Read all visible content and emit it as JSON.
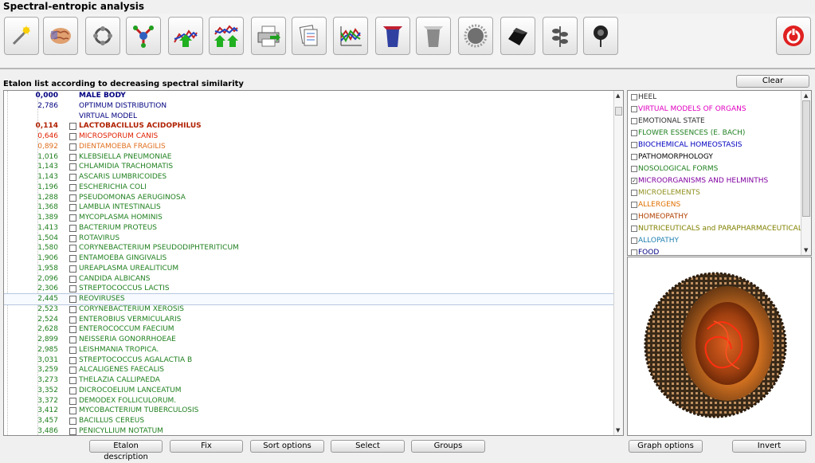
{
  "window": {
    "title": "Spectral-entropic analysis"
  },
  "toolbar": {
    "buttons": [
      {
        "name": "wand-button",
        "icon": "magic-wand-icon"
      },
      {
        "name": "brain-button",
        "icon": "brain-icon"
      },
      {
        "name": "molecule-button",
        "icon": "molecule-icon"
      },
      {
        "name": "network-button",
        "icon": "network-icon"
      },
      {
        "name": "graph-up-button",
        "icon": "graph-up-icon"
      },
      {
        "name": "graph-compare-button",
        "icon": "graph-compare-icon"
      },
      {
        "name": "print-button",
        "icon": "printer-icon"
      },
      {
        "name": "documents-button",
        "icon": "documents-icon"
      },
      {
        "name": "spectrum-button",
        "icon": "spectrum-icon"
      },
      {
        "name": "blue-cup-button",
        "icon": "blue-cup-icon"
      },
      {
        "name": "grey-cup-button",
        "icon": "grey-cup-icon"
      },
      {
        "name": "virus-button",
        "icon": "virus-icon"
      },
      {
        "name": "microscope-button",
        "icon": "microscope-icon"
      },
      {
        "name": "black-stone-button",
        "icon": "black-stone-icon"
      },
      {
        "name": "plant-button",
        "icon": "plant-icon"
      },
      {
        "name": "flower-button",
        "icon": "flower-icon"
      }
    ],
    "power_icon": "power-icon"
  },
  "etalon": {
    "title": "Etalon list according to decreasing spectral similarity",
    "clear_label": "Clear",
    "rows": [
      {
        "value": "0,000",
        "name": "MALE BODY",
        "checkbox": false,
        "bold": true,
        "color": "#000080"
      },
      {
        "value": "2,786",
        "name": "OPTIMUM DISTRIBUTION",
        "checkbox": false,
        "color": "#000080"
      },
      {
        "value": "",
        "name": "VIRTUAL MODEL",
        "checkbox": false,
        "color": "#000080"
      },
      {
        "value": "0,114",
        "name": "LACTOBACILLUS ACIDOPHILUS",
        "checkbox": true,
        "bold": true,
        "color": "#b02000"
      },
      {
        "value": "0,646",
        "name": "MICROSPORUM  CANIS",
        "checkbox": true,
        "color": "#e02000"
      },
      {
        "value": "0,892",
        "name": "DIENTAMOEBA FRAGILIS",
        "checkbox": true,
        "color": "#e07020"
      },
      {
        "value": "1,016",
        "name": "KLEBSIELLA PNEUMONIAE",
        "checkbox": true,
        "color": "#208020"
      },
      {
        "value": "1,143",
        "name": "CHLAMIDIA  TRACHOMATIS",
        "checkbox": true,
        "color": "#208020"
      },
      {
        "value": "1,143",
        "name": "ASCARIS  LUMBRICOIDES",
        "checkbox": true,
        "color": "#208020"
      },
      {
        "value": "1,196",
        "name": "ESCHERICHIA  COLI",
        "checkbox": true,
        "color": "#208020"
      },
      {
        "value": "1,288",
        "name": "PSEUDOMONAS  AERUGINOSA",
        "checkbox": true,
        "color": "#208020"
      },
      {
        "value": "1,368",
        "name": "LAMBLIA  INTESTINALIS",
        "checkbox": true,
        "color": "#208020"
      },
      {
        "value": "1,389",
        "name": "MYCOPLASMA  HOMINIS",
        "checkbox": true,
        "color": "#208020"
      },
      {
        "value": "1,413",
        "name": "BACTERIUM  PROTEUS",
        "checkbox": true,
        "color": "#208020"
      },
      {
        "value": "1,504",
        "name": "ROTAVIRUS",
        "checkbox": true,
        "color": "#208020"
      },
      {
        "value": "1,580",
        "name": "CORYNEBACTERIUM PSEUDODIPHTERITICUM",
        "checkbox": true,
        "color": "#208020"
      },
      {
        "value": "1,906",
        "name": "ENTAMOEBA GINGIVALIS",
        "checkbox": true,
        "color": "#208020"
      },
      {
        "value": "1,958",
        "name": "UREAPLASMA  UREALITICUM",
        "checkbox": true,
        "color": "#208020"
      },
      {
        "value": "2,096",
        "name": "CANDIDA  ALBICANS",
        "checkbox": true,
        "color": "#208020"
      },
      {
        "value": "2,306",
        "name": "STREPTOCOCCUS LACTIS",
        "checkbox": true,
        "color": "#208020"
      },
      {
        "value": "2,445",
        "name": "REOVIRUSES",
        "checkbox": true,
        "color": "#208020",
        "highlight": true
      },
      {
        "value": "2,523",
        "name": "CORYNEBACTERIUM XEROSIS",
        "checkbox": true,
        "color": "#208020"
      },
      {
        "value": "2,524",
        "name": "ENTEROBIUS  VERMICULARIS",
        "checkbox": true,
        "color": "#208020"
      },
      {
        "value": "2,628",
        "name": "ENTEROCOCCUM  FAECIUM",
        "checkbox": true,
        "color": "#208020"
      },
      {
        "value": "2,899",
        "name": "NEISSERIA  GONORRHOEAE",
        "checkbox": true,
        "color": "#208020"
      },
      {
        "value": "2,985",
        "name": "LEISHMANIA TROPICA.",
        "checkbox": true,
        "color": "#208020"
      },
      {
        "value": "3,031",
        "name": "STREPTOCOCCUS AGALACTIA  B",
        "checkbox": true,
        "color": "#208020"
      },
      {
        "value": "3,259",
        "name": "ALCALIGENES FAECALIS",
        "checkbox": true,
        "color": "#208020"
      },
      {
        "value": "3,273",
        "name": "THELAZIA CALLIPAEDA",
        "checkbox": true,
        "color": "#208020"
      },
      {
        "value": "3,352",
        "name": "DICROCOELIUM LANCEATUM",
        "checkbox": true,
        "color": "#208020"
      },
      {
        "value": "3,372",
        "name": "DEMODEX FOLLICULORUM.",
        "checkbox": true,
        "color": "#208020"
      },
      {
        "value": "3,412",
        "name": "MYCOBACTERIUM  TUBERCULOSIS",
        "checkbox": true,
        "color": "#208020"
      },
      {
        "value": "3,457",
        "name": "BACILLUS CEREUS",
        "checkbox": true,
        "color": "#208020"
      },
      {
        "value": "3,486",
        "name": "PENICYLLIUM  NOTATUM",
        "checkbox": true,
        "color": "#208020"
      }
    ]
  },
  "categories": [
    {
      "name": "HEEL",
      "color": "#303030",
      "checked": false
    },
    {
      "name": "VIRTUAL MODELS OF ORGANS",
      "color": "#e000c0",
      "checked": false
    },
    {
      "name": "EMOTIONAL STATE",
      "color": "#303030",
      "checked": false
    },
    {
      "name": "FLOWER ESSENCES (E. BACH)",
      "color": "#208020",
      "checked": false
    },
    {
      "name": "BIOCHEMICAL HOMEOSTASIS",
      "color": "#0000c0",
      "checked": false
    },
    {
      "name": "PATHOMORPHOLOGY",
      "color": "#000000",
      "checked": false
    },
    {
      "name": "NOSOLOGICAL FORMS",
      "color": "#208020",
      "checked": false
    },
    {
      "name": "MICROORGANISMS AND HELMINTHS",
      "color": "#8000a0",
      "checked": true
    },
    {
      "name": "MICROELEMENTS",
      "color": "#909020",
      "checked": false
    },
    {
      "name": "ALLERGENS",
      "color": "#e07000",
      "checked": false
    },
    {
      "name": "HOMEOPATHY",
      "color": "#b04000",
      "checked": false
    },
    {
      "name": "NUTRICEUTICALS and PARAPHARMACEUTICALS",
      "color": "#808000",
      "checked": false
    },
    {
      "name": "ALLOPATHY",
      "color": "#2080b0",
      "checked": false
    },
    {
      "name": "FOOD",
      "color": "#000080",
      "checked": false
    }
  ],
  "image": {
    "icon": "virus-3d-icon"
  },
  "bottom": {
    "etalon_description": "Etalon description",
    "fix": "Fix",
    "sort_options": "Sort options",
    "select": "Select",
    "groups": "Groups",
    "graph_options": "Graph options",
    "invert": "Invert"
  }
}
